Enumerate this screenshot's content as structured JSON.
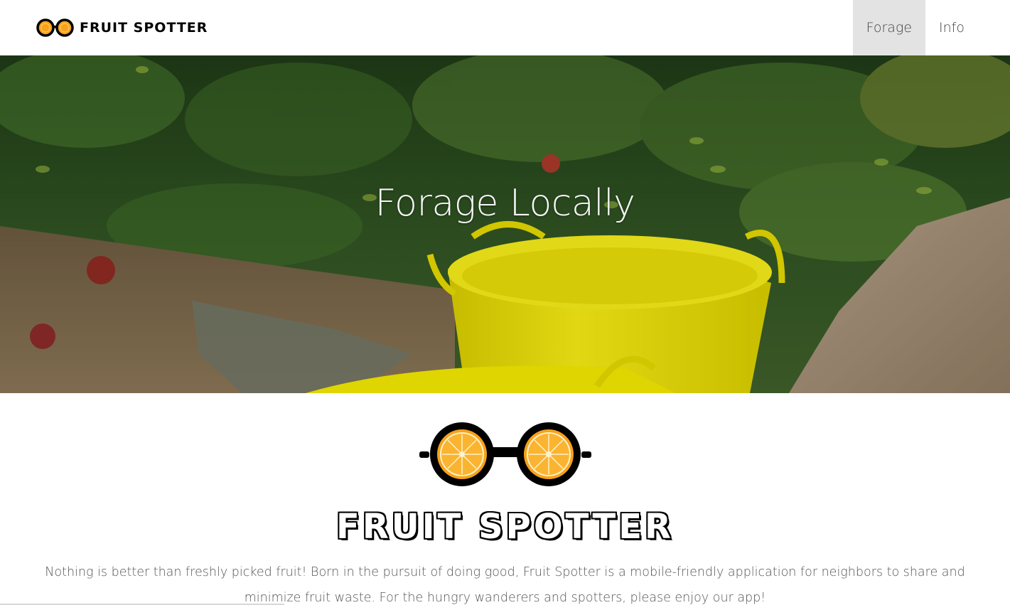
{
  "navbar": {
    "brand": "FRUIT SPOTTER",
    "items": [
      {
        "label": "Forage",
        "active": true
      },
      {
        "label": "Info",
        "active": false
      }
    ]
  },
  "hero": {
    "title": "Forage Locally"
  },
  "content": {
    "logo_title": "FRUIT SPOTTER",
    "description": "Nothing is better than freshly picked fruit! Born in the pursuit of doing good, Fruit Spotter is a mobile-friendly application for neighbors to share and minimize fruit waste. For the hungry wanderers and spotters, please enjoy our app!"
  },
  "colors": {
    "orange": "#f7a21b",
    "bucket_yellow": "#f2e600",
    "nav_active_bg": "#e3e3e3"
  }
}
